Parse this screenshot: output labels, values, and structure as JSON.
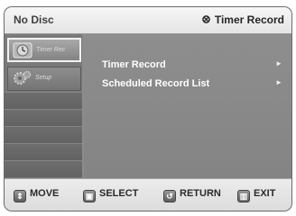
{
  "title_bar": {
    "disc_status": "No Disc",
    "menu_title": "Timer Record",
    "record_icon": "record-circle-icon"
  },
  "sidebar": {
    "items": [
      {
        "label": "Timer Rec",
        "icon": "clock-icon",
        "selected": true
      },
      {
        "label": "Setup",
        "icon": "gear-icon",
        "selected": false
      }
    ]
  },
  "menu": {
    "items": [
      {
        "label": "Timer Record",
        "icon": "arrow-right-icon"
      },
      {
        "label": "Scheduled Record List",
        "icon": "arrow-right-icon"
      }
    ]
  },
  "hints": {
    "move": "MOVE",
    "select": "SELECT",
    "return": "RETURN",
    "exit": "EXIT"
  },
  "colors": {
    "panel_bg": "#8c8c8c",
    "bar_bg": "#e6e6e6",
    "menu_text": "#ffffff"
  }
}
